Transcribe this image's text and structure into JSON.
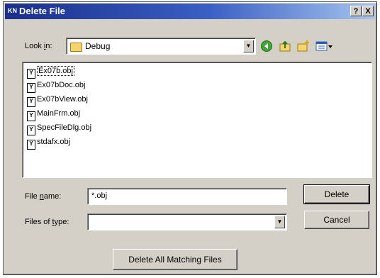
{
  "window": {
    "title": "Delete File",
    "title_icon": "KN",
    "help_button": "?",
    "close_button": "X"
  },
  "look_in": {
    "label_prefix": "Look ",
    "label_ul": "i",
    "label_suffix": "n:",
    "value": "Debug"
  },
  "toolbar": {
    "icons": [
      "back-icon",
      "up-folder-icon",
      "new-folder-icon",
      "view-menu-icon"
    ]
  },
  "files": [
    {
      "name": "Ex07b.obj",
      "selected": true
    },
    {
      "name": "Ex07bDoc.obj",
      "selected": false
    },
    {
      "name": "Ex07bView.obj",
      "selected": false
    },
    {
      "name": "MainFrm.obj",
      "selected": false
    },
    {
      "name": "SpecFileDlg.obj",
      "selected": false
    },
    {
      "name": "stdafx.obj",
      "selected": false
    }
  ],
  "file_name": {
    "label_prefix": "File ",
    "label_ul": "n",
    "label_suffix": "ame:",
    "value": "*.obj"
  },
  "file_type": {
    "label_prefix": "Files of ",
    "label_ul": "t",
    "label_suffix": "ype:",
    "value": ""
  },
  "buttons": {
    "delete": "Delete",
    "cancel": "Cancel",
    "delete_all": "Delete All Matching Files"
  },
  "colors": {
    "titlebar_start": "#1b2f8c",
    "titlebar_end": "#a6c4ef",
    "face": "#d4d0c8"
  }
}
